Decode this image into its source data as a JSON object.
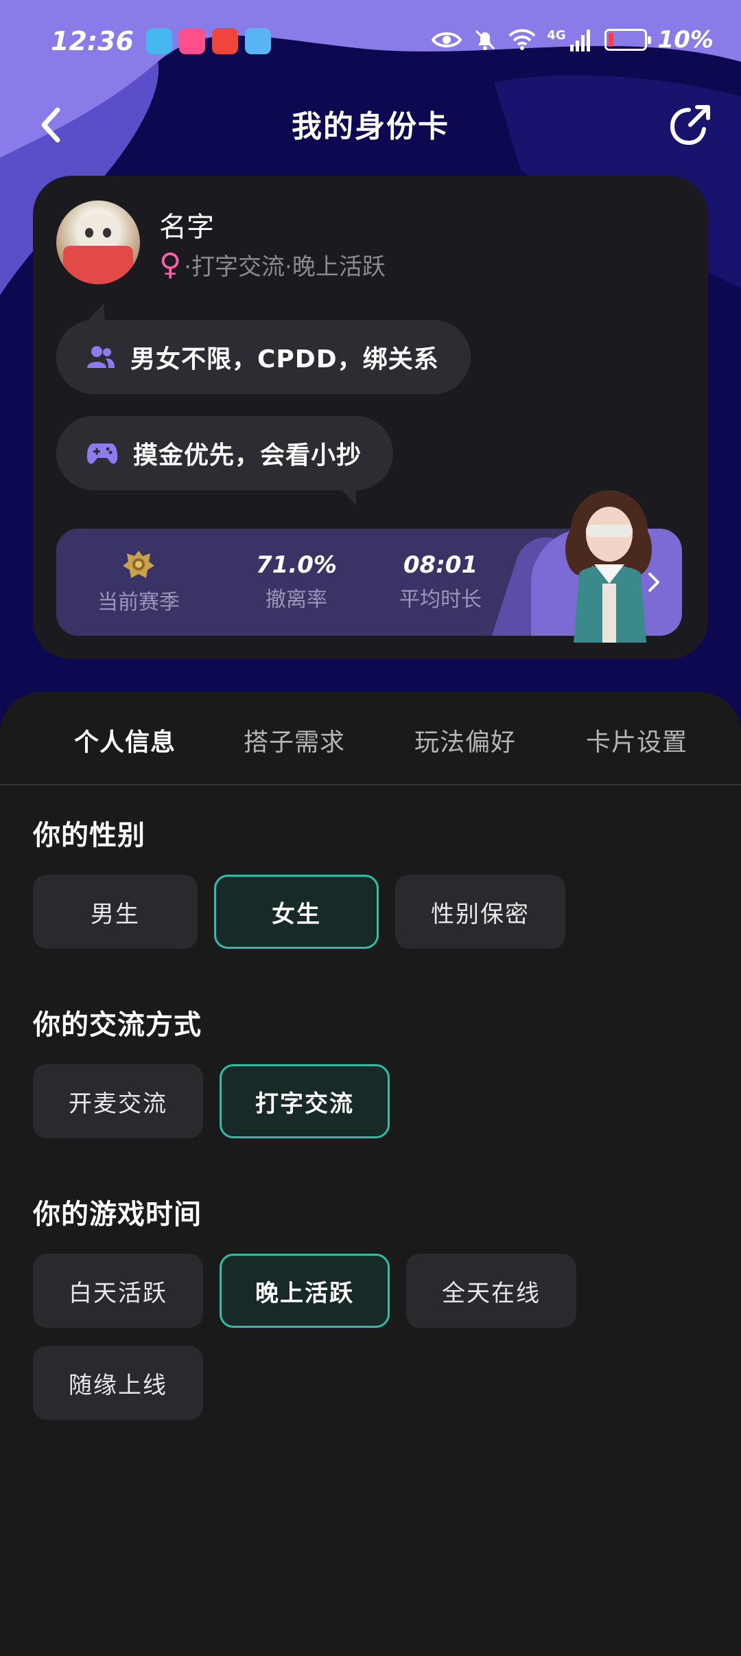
{
  "status_bar": {
    "time": "12:36",
    "network": "4G",
    "battery_text": "10%",
    "battery_level_percent": 10
  },
  "header": {
    "title": "我的身份卡"
  },
  "profile": {
    "name": "名字",
    "gender_symbol": "♀",
    "subtitle": "·打字交流·晚上活跃",
    "tags": [
      {
        "icon": "users-icon",
        "text": "男女不限，CPDD，绑关系"
      },
      {
        "icon": "gamepad-icon",
        "text": "摸金优先，会看小抄"
      }
    ],
    "stats": [
      {
        "value": "",
        "label": "当前赛季",
        "icon": "rank-badge-icon"
      },
      {
        "value": "71.0%",
        "label": "撤离率"
      },
      {
        "value": "08:01",
        "label": "平均时长"
      }
    ]
  },
  "tabs": [
    {
      "label": "个人信息",
      "active": true
    },
    {
      "label": "搭子需求",
      "active": false
    },
    {
      "label": "玩法偏好",
      "active": false
    },
    {
      "label": "卡片设置",
      "active": false
    }
  ],
  "sections": {
    "gender": {
      "title": "你的性别",
      "options": [
        "男生",
        "女生",
        "性别保密"
      ],
      "selected": "女生"
    },
    "communication": {
      "title": "你的交流方式",
      "options": [
        "开麦交流",
        "打字交流"
      ],
      "selected": "打字交流"
    },
    "game_time": {
      "title": "你的游戏时间",
      "options": [
        "白天活跃",
        "晚上活跃",
        "全天在线",
        "随缘上线"
      ],
      "selected": "晚上活跃"
    }
  },
  "colors": {
    "hero_bg": "#0c0950",
    "hero_wave": "#8a7ce8",
    "accent_selected": "#2fbfa8",
    "stats_bg": "#3a3466",
    "female": "#ff5fa8"
  }
}
